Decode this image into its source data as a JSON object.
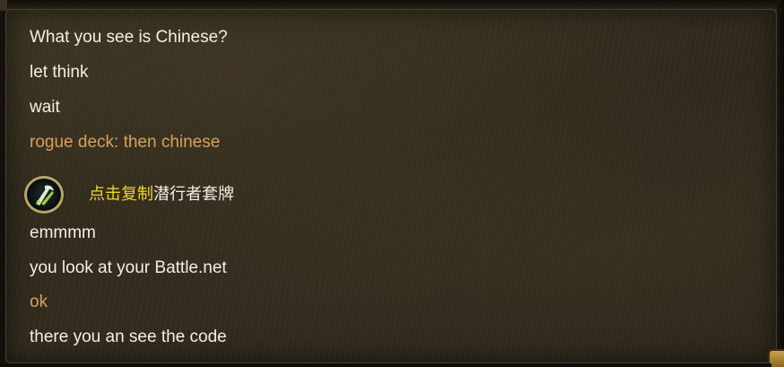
{
  "chat": {
    "messages": [
      {
        "text": "What you see is Chinese?",
        "color": "#f2efe8"
      },
      {
        "text": "let think",
        "color": "#f2efe8"
      },
      {
        "text": "wait",
        "color": "#f2efe8"
      },
      {
        "text": "rogue deck: then chinese",
        "color": "#d9a05a"
      },
      {
        "text": "emmmm",
        "color": "#f2efe8"
      },
      {
        "text": "you look at your Battle.net",
        "color": "#f2efe8"
      },
      {
        "text": "ok",
        "color": "#d9a05a"
      },
      {
        "text": "there you an see the code",
        "color": "#f2efe8"
      }
    ],
    "deck_share": {
      "icon": "rogue-class-icon",
      "copy_label": "点击复制",
      "deck_name": "潜行者套牌",
      "copy_color": "#f3d420"
    }
  },
  "theme": {
    "background": "#2f291c",
    "own_message_color": "#f2efe8",
    "friend_message_color": "#d9a05a"
  }
}
